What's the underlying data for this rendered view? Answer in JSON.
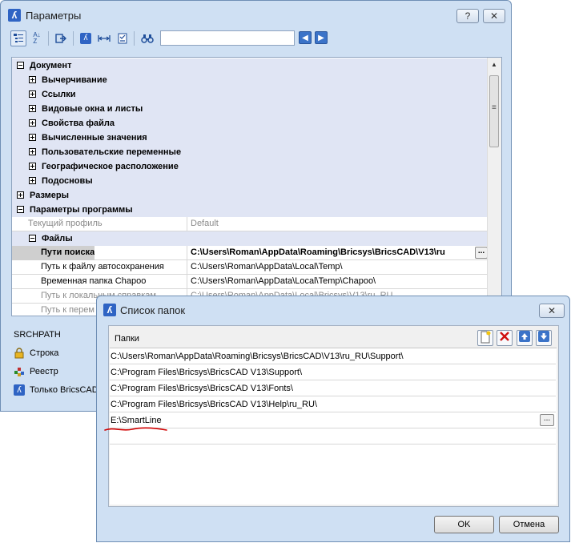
{
  "main_window": {
    "title": "Параметры",
    "help_label": "?",
    "close_label": "✕",
    "toolbar": {
      "search_value": "",
      "prev_label": "◀",
      "next_label": "▶"
    },
    "tree": {
      "document": "Документ",
      "document_children": [
        "Вычерчивание",
        "Ссылки",
        "Видовые окна и листы",
        "Свойства файла",
        "Вычисленные значения",
        "Пользовательские переменные",
        "Географическое расположение",
        "Подосновы"
      ],
      "sizes": "Размеры",
      "program_params": "Параметры программы",
      "current_profile": {
        "name": "Текущий профиль",
        "value": "Default"
      },
      "files": "Файлы",
      "file_props": [
        {
          "name": "Пути поиска",
          "value": "C:\\Users\\Roman\\AppData\\Roaming\\Bricsys\\BricsCAD\\V13\\ru"
        },
        {
          "name": "Путь к файлу автосохранения",
          "value": "C:\\Users\\Roman\\AppData\\Local\\Temp\\"
        },
        {
          "name": "Временная папка Chapoo",
          "value": "C:\\Users\\Roman\\AppData\\Local\\Temp\\Chapoo\\"
        },
        {
          "name": "Путь к локальным справкам",
          "value": "C:\\Users\\Roman\\AppData\\Local\\Bricsys\\V13\\ru_RU"
        },
        {
          "name": "Путь к перем",
          "value": ""
        }
      ],
      "ellipsis": "..."
    },
    "variable_name": "SRCHPATH",
    "lower_items": [
      {
        "label": "Строка",
        "icon": "lock-icon"
      },
      {
        "label": "Реестр",
        "icon": "registry-icon"
      },
      {
        "label": "Только BricsCAD",
        "icon": "bricscad-icon"
      }
    ]
  },
  "folder_dialog": {
    "title": "Список папок",
    "close_label": "✕",
    "folders_label": "Папки",
    "folders": [
      "C:\\Users\\Roman\\AppData\\Roaming\\Bricsys\\BricsCAD\\V13\\ru_RU\\Support\\",
      "C:\\Program Files\\Bricsys\\BricsCAD V13\\Support\\",
      "C:\\Program Files\\Bricsys\\BricsCAD V13\\Fonts\\",
      "C:\\Program Files\\Bricsys\\BricsCAD V13\\Help\\ru_RU\\",
      "E:\\SmartLine",
      ""
    ],
    "ellipsis": "...",
    "ok_label": "OK",
    "cancel_label": "Отмена"
  },
  "colors": {
    "window_bg": "#cfe0f3",
    "category_bg": "#e0e5f4",
    "accent_blue": "#3b73c8",
    "delete_red": "#d01010",
    "annotation_red": "#d00000"
  }
}
